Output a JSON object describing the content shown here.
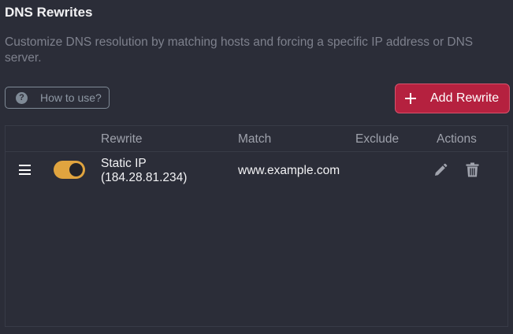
{
  "header": {
    "title": "DNS Rewrites",
    "description": "Customize DNS resolution by matching hosts and forcing a specific IP address or DNS server."
  },
  "toolbar": {
    "help_icon": "question-circle-icon",
    "help_label": "How to use?",
    "add_icon": "plus-icon",
    "add_label": "Add Rewrite"
  },
  "table": {
    "columns": [
      "Rewrite",
      "Match",
      "Exclude",
      "Actions"
    ],
    "rows": [
      {
        "enabled": true,
        "rewrite_line1": "Static IP",
        "rewrite_line2": "(184.28.81.234)",
        "match": "www.example.com",
        "exclude": "",
        "actions": [
          "pencil-icon",
          "trash-icon"
        ]
      }
    ]
  },
  "colors": {
    "background": "#2b2d38",
    "accent_red": "#b5213f",
    "toggle_on": "#e0a43f",
    "muted_text": "#7e818d"
  }
}
